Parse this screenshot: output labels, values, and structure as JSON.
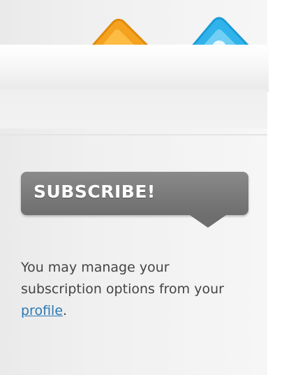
{
  "sidebar": {
    "icons": [
      "orange-feed-icon",
      "blue-mail-icon"
    ],
    "subscribe": {
      "title": "SUBSCRIBE!",
      "text_before": "You may manage your subscription options from your ",
      "link_label": "profile",
      "text_after": "."
    }
  },
  "colors": {
    "badge": "#6e6e6e",
    "link": "#2b79b5",
    "orange_icon": "#f5a623",
    "blue_icon": "#39b5e6"
  }
}
